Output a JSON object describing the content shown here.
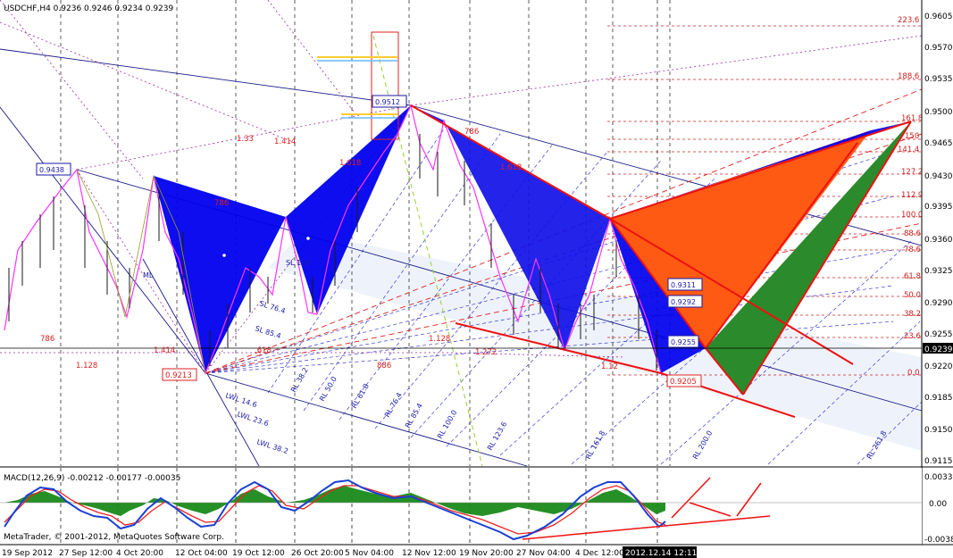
{
  "window": {
    "title": "USDCHF,H4  0.9236 0.9246 0.9234 0.9239"
  },
  "price_axis": {
    "ticks": [
      "0.9605",
      "0.9570",
      "0.9535",
      "0.9500",
      "0.9465",
      "0.9430",
      "0.9395",
      "0.9360",
      "0.9325",
      "0.9290",
      "0.9255",
      "0.9220",
      "0.9185",
      "0.9150",
      "0.9115"
    ],
    "current_price": "0.9239"
  },
  "macd": {
    "title": "MACD(12,26,9) -0.00212 -0.00177 -0.00035",
    "ticks": [
      "0.0033",
      "0.00",
      "-0.0038"
    ],
    "copyright": "MetaTrader, © 2001-2012, MetaQuotes Software Corp."
  },
  "time_axis": {
    "labels": [
      "19 Sep 2012",
      "27 Sep 12:00",
      "4 Oct 20:00",
      "12 Oct 04:00",
      "19 Oct 12:00",
      "26 Oct 20:00",
      "5 Nov 04:00",
      "12 Nov 12:00",
      "19 Nov 20:00",
      "27 Nov 04:00",
      "4 Dec 12:00"
    ],
    "cursor_time": "2012.12.14 12:11"
  },
  "fib_levels": [
    "223.6",
    "188.6",
    "161.8",
    "150",
    "141.4",
    "127.2",
    "112.9",
    "100.0",
    "88.6",
    "78.6",
    "61.8",
    "50.0",
    "38.2",
    "23.6",
    "0.0"
  ],
  "price_boxes": {
    "high_9512": "0.9512",
    "left_9438": "0.9438",
    "low_9213": "0.9213",
    "low_9205": "0.9205",
    "box_9311": "0.9311",
    "box_9292": "0.9292",
    "box_9255": "0.9255"
  },
  "pitchfork_labels": [
    "LWL 14.6",
    "LWL 23.6",
    "LWL 38.2",
    "RL 38.2",
    "RL 50.0",
    "RL 61.8",
    "RL 76.4",
    "RL 85.4",
    "RL 100.0",
    "RL 123.6",
    "RL 161.8",
    "RL 200.0",
    "RL 261.8",
    "ML",
    "SL 76.4",
    "SL 85.4",
    "SL 100"
  ],
  "ratio_labels": [
    "1.33",
    "1.414",
    "786",
    "1.128",
    "1.414",
    ".618",
    "886",
    "1.128",
    "1.272",
    "1.12",
    "786",
    "1.618",
    "786",
    "1.618"
  ],
  "colors": {
    "background": "#ffffff",
    "blue_pattern": "#0000ee",
    "orange_pattern": "#ff5a14",
    "green_pattern": "#2b8a2b",
    "channel_fill": "#eef3ff",
    "price_line": "#ff33ff",
    "macd_up": "#1a8a1a",
    "macd_signal": "#ee2222",
    "macd_main": "#1a3fd6"
  }
}
